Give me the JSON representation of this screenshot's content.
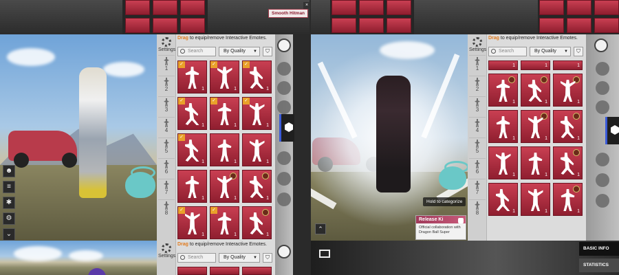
{
  "panels": {
    "settings_label": "Settings",
    "hint_prefix": "Drag",
    "hint_rest": " to equip/remove Interactive Emotes.",
    "search_placeholder": "Search",
    "sort_label": "By Quality"
  },
  "slots": [
    "1",
    "2",
    "3",
    "4",
    "5",
    "6",
    "7",
    "8"
  ],
  "tile_count": "1",
  "top_tooltip": {
    "label": "Smooth Hitman"
  },
  "right_view": {
    "hold_tip": "Hold to categorize",
    "emote_name": "Release Ki",
    "emote_desc": "Official collaboration with Dragon Ball Super"
  },
  "info_tabs": {
    "basic": "BASIC INFO",
    "stats": "STATISTICS"
  },
  "colors": {
    "tile": "#b0303f",
    "accent_orange": "#e07b1f",
    "rail_active": "#3b5bd8"
  },
  "icons": [
    "search-icon",
    "filter-icon",
    "chevron-down-icon",
    "gear-icon",
    "emote-face-icon",
    "cube-icon",
    "expand-icon",
    "chevron-up-icon",
    "close-icon"
  ]
}
